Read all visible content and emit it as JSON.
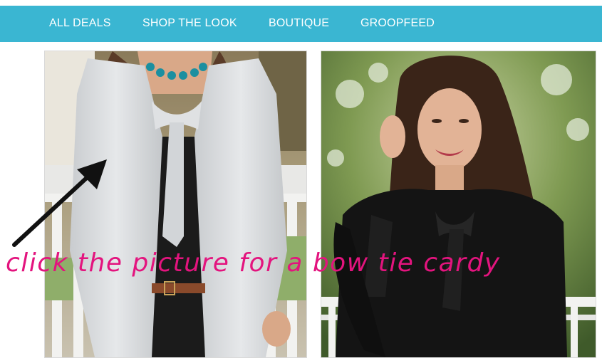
{
  "nav": {
    "items": [
      {
        "label": "ALL DEALS"
      },
      {
        "label": "SHOP THE LOOK"
      },
      {
        "label": "BOUTIQUE"
      },
      {
        "label": "GROOPFEED"
      }
    ]
  },
  "main": {
    "annotation": "click the picture for a bow tie cardy"
  },
  "colors": {
    "nav_bg": "#3ab6d2",
    "annotation": "#e3147e"
  },
  "icons": [
    "arrow-icon"
  ]
}
